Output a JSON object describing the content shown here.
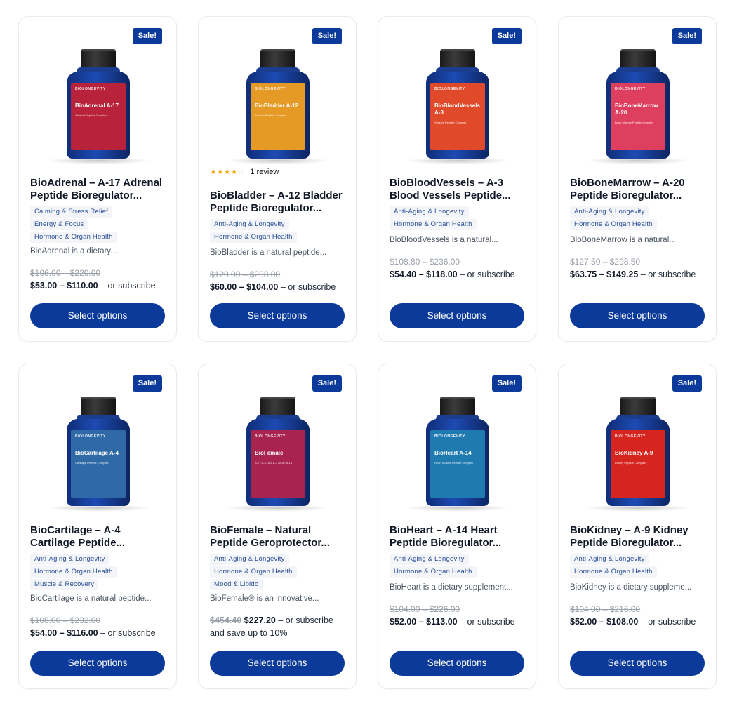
{
  "sale_label": "Sale!",
  "button_label": "Select options",
  "subscribe_text": "– or subscribe",
  "brand_text": "BIOLONGEVITY",
  "products": [
    {
      "name": "BioAdrenal – A-17 Adrenal Peptide Bioregulator...",
      "bottle_name": "BioAdrenal A-17",
      "bottle_sub": "Adrenal Peptide Complex",
      "label_color": "#b8233b",
      "tags": [
        "Calming & Stress Relief",
        "Energy & Focus",
        "Hormone & Organ Health"
      ],
      "description": "BioAdrenal is a dietary...",
      "old_price": "$106.00 – $220.00",
      "price_low": "$53.00",
      "price_high": "$110.00"
    },
    {
      "name": "BioBladder – A-12 Bladder Peptide Bioregulator...",
      "bottle_name": "BioBladder A-12",
      "bottle_sub": "Bladder Peptide Complex",
      "label_color": "#e59a26",
      "rating": "4",
      "rating_text": "1 review",
      "tags": [
        "Anti-Aging & Longevity",
        "Hormone & Organ Health"
      ],
      "description": "BioBladder is a natural peptide...",
      "old_price": "$120.00 – $208.00",
      "price_low": "$60.00",
      "price_high": "$104.00"
    },
    {
      "name": "BioBloodVessels – A-3 Blood Vessels Peptide...",
      "bottle_name": "BioBloodVessels A-3",
      "bottle_sub": "Vessels Peptide Complex",
      "label_color": "#e04a2a",
      "tags": [
        "Anti-Aging & Longevity",
        "Hormone & Organ Health"
      ],
      "description": "BioBloodVessels is a natural...",
      "old_price": "$108.80 – $236.00",
      "price_low": "$54.40",
      "price_high": "$118.00"
    },
    {
      "name": "BioBoneMarrow – A-20 Peptide Bioregulator...",
      "bottle_name": "BioBoneMarrow A-20",
      "bottle_sub": "Bone Marrow Peptide Complex",
      "label_color": "#de3f5f",
      "tags": [
        "Anti-Aging & Longevity",
        "Hormone & Organ Health"
      ],
      "description": "BioBoneMarrow is a natural...",
      "old_price": "$127.50 – $298.50",
      "price_low": "$63.75",
      "price_high": "$149.25"
    },
    {
      "name": "BioCartilage – A-4 Cartilage Peptide...",
      "bottle_name": "BioCartilage A-4",
      "bottle_sub": "Cartilage Peptide Complex",
      "label_color": "#2f6aa7",
      "tags": [
        "Anti-Aging & Longevity",
        "Hormone & Organ Health",
        "Muscle & Recovery"
      ],
      "description": "BioCartilage is a natural peptide...",
      "old_price": "$108.00 – $232.00",
      "price_low": "$54.00",
      "price_high": "$116.00"
    },
    {
      "name": "BioFemale – Natural Peptide Geroprotector...",
      "bottle_name": "BioFemale",
      "bottle_sub": "A-2 / A-3 / A-5 A-7 / A-8 / A-15",
      "label_color": "#a8234f",
      "tags": [
        "Anti-Aging & Longevity",
        "Hormone & Organ Health",
        "Mood & Libido"
      ],
      "description": "BioFemale® is an innovative...",
      "single_old": "$454.40",
      "single_price": "$227.20",
      "save_text": "and save up to 10%"
    },
    {
      "name": "BioHeart – A-14 Heart Peptide Bioregulator...",
      "bottle_name": "BioHeart A-14",
      "bottle_sub": "Heart Muscle Peptide Complex",
      "label_color": "#1f7ab0",
      "tags": [
        "Anti-Aging & Longevity",
        "Hormone & Organ Health"
      ],
      "description": "BioHeart is a dietary supplement...",
      "old_price": "$104.00 – $226.00",
      "price_low": "$52.00",
      "price_high": "$113.00"
    },
    {
      "name": "BioKidney – A-9 Kidney Peptide Bioregulator...",
      "bottle_name": "BioKidney A-9",
      "bottle_sub": "Kidney Peptide Complex",
      "label_color": "#d6251f",
      "tags": [
        "Anti-Aging & Longevity",
        "Hormone & Organ Health"
      ],
      "description": "BioKidney is a dietary suppleme...",
      "old_price": "$104.00 – $216.00",
      "price_low": "$52.00",
      "price_high": "$108.00"
    }
  ]
}
